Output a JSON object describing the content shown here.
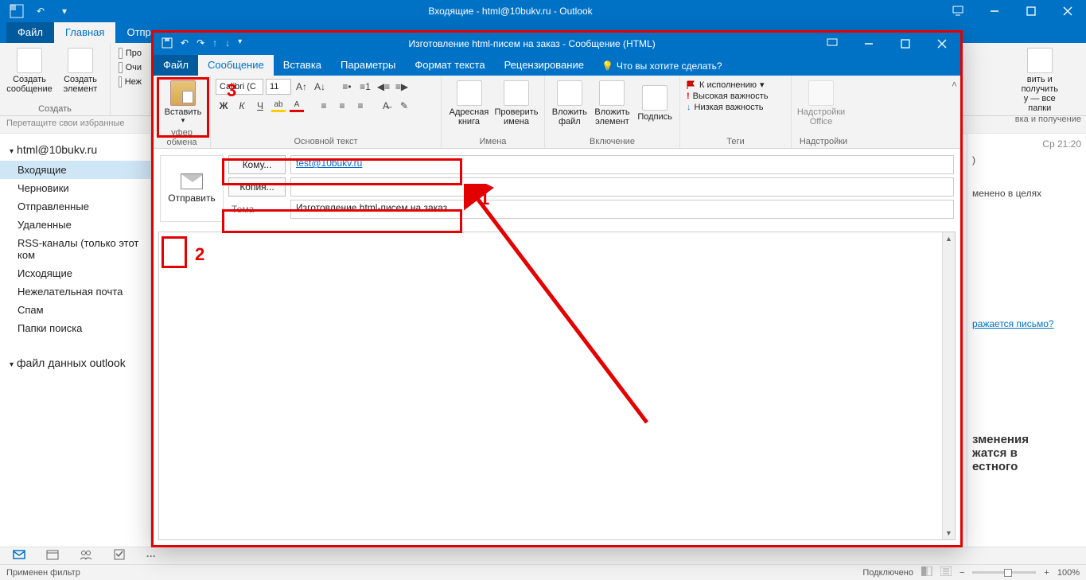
{
  "main_window": {
    "title": "Входящие - html@10bukv.ru - Outlook",
    "tabs": {
      "file": "Файл",
      "home": "Главная",
      "sendrecv": "Отпра"
    },
    "ribbon": {
      "new_mail": "Создать сообщение",
      "new_item": "Создать элемент",
      "group_new": "Создать",
      "pro": "Про",
      "clean": "Очи",
      "junk": "Неж",
      "right_big": "вить и получить",
      "right_small": "у — все папки",
      "right_group": "вка и получение"
    },
    "hint": "Перетащите свои избранные",
    "account": "html@10bukv.ru",
    "folders": [
      "Входящие",
      "Черновики",
      "Отправленные",
      "Удаленные",
      "RSS-каналы (только этот ком",
      "Исходящие",
      "Нежелательная почта",
      "Спам",
      "Папки поиска"
    ],
    "folder_selected": 0,
    "data_file": "файл данных outlook",
    "preview": {
      "date": "Ср 21:20",
      "fragA_suffix": ")",
      "fragB": "менено в целях",
      "link": "ражается письмо?",
      "p1": "зменения",
      "p2": "жатся в",
      "p3": "естного"
    },
    "status": {
      "left": "Применен фильтр",
      "conn": "Подключено",
      "zoom": "100%"
    }
  },
  "compose": {
    "title": "Изготовление html-писем на заказ - Сообщение (HTML)",
    "tabs": {
      "file": "Файл",
      "message": "Сообщение",
      "insert": "Вставка",
      "options": "Параметры",
      "format": "Формат текста",
      "review": "Рецензирование",
      "tell": "Что вы хотите сделать?"
    },
    "ribbon": {
      "clipboard": {
        "paste": "Вставить",
        "group": "уфер обмена"
      },
      "font": {
        "name": "Calibri (С",
        "size": "11",
        "group": "Основной текст",
        "bold": "Ж",
        "italic": "К",
        "underline": "Ч"
      },
      "names": {
        "address": "Адресная книга",
        "check": "Проверить имена",
        "group": "Имена"
      },
      "include": {
        "attach_file": "Вложить файл",
        "attach_item": "Вложить элемент",
        "signature": "Подпись",
        "group": "Включение"
      },
      "tags": {
        "followup": "К исполнению",
        "high": "Высокая важность",
        "low": "Низкая важность",
        "group": "Теги"
      },
      "addins": {
        "label": "Надстройки Office",
        "group": "Надстройки"
      }
    },
    "header": {
      "send": "Отправить",
      "to_label": "Кому...",
      "to_value": "test@10bukv.ru",
      "cc_label": "Копия...",
      "subject_label": "Тема",
      "subject_value": "Изготовление html-писем на заказ"
    }
  },
  "annotations": {
    "num1": "1",
    "num2": "2",
    "num3": "3"
  }
}
